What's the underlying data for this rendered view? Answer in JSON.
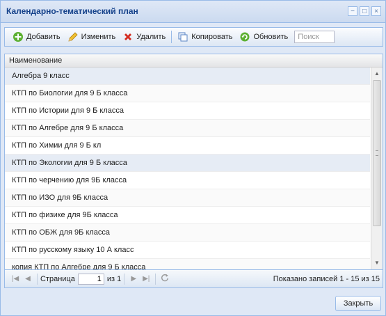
{
  "window": {
    "title": "Календарно-тематический план",
    "controls": [
      "−",
      "□",
      "×"
    ]
  },
  "toolbar": {
    "add_label": "Добавить",
    "edit_label": "Изменить",
    "delete_label": "Удалить",
    "copy_label": "Копировать",
    "refresh_label": "Обновить",
    "search_placeholder": "Поиск"
  },
  "grid": {
    "column_header": "Наименование",
    "rows": [
      "Алгебра 9 класс",
      "КТП по Биологии для 9 Б класса",
      "КТП по Истории для 9 Б класса",
      "КТП по Алгебре для 9 Б класса",
      "КТП по Химии для 9 Б кл",
      "КТП по Экологии для 9 Б класса",
      "КТП по черчению для 9Б класса",
      "КТП по ИЗО для 9Б класса",
      "КТП по физике для 9Б класса",
      "КТП по ОБЖ для 9Б класса",
      "КТП по русскому языку 10 А класс",
      "копия КТП по Алгебре для 9 Б класса"
    ]
  },
  "paging": {
    "page_label": "Страница",
    "current_page": "1",
    "of_label": "из 1",
    "info": "Показано записей 1 - 15 из 15"
  },
  "footer": {
    "close_label": "Закрыть"
  },
  "colors": {
    "accent": "#15428b",
    "border": "#99bbe8",
    "window_bg": "#dfe8f6"
  }
}
